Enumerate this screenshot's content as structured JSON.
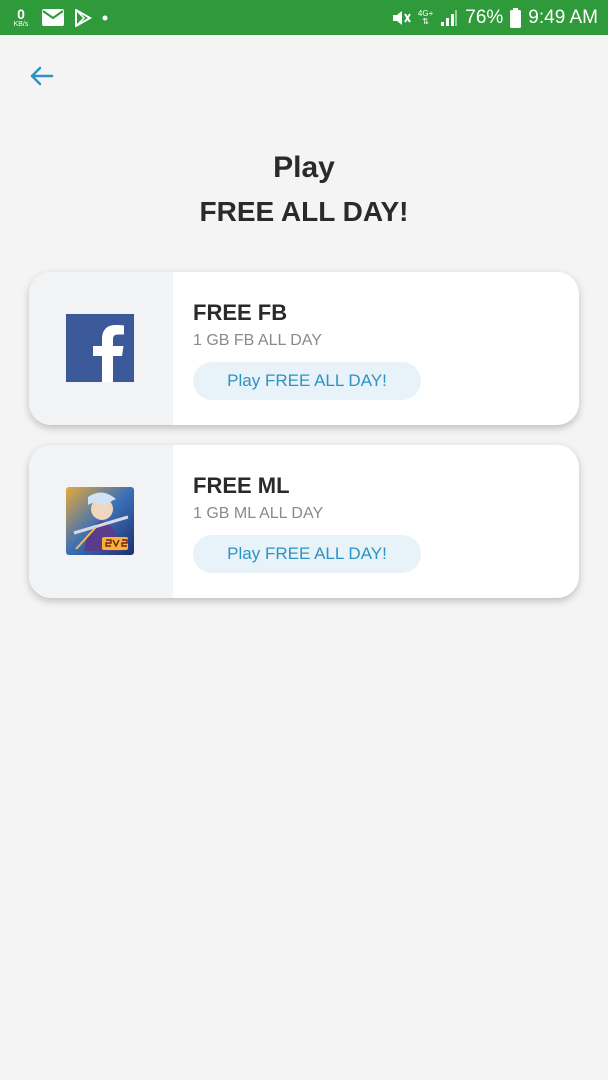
{
  "status_bar": {
    "net_speed_value": "0",
    "net_speed_unit": "KB/s",
    "network_type": "4G+",
    "battery": "76%",
    "time": "9:49 AM",
    "bg_color": "#2e9a3a"
  },
  "heading": {
    "line1": "Play",
    "line2": "FREE ALL DAY!"
  },
  "cards": [
    {
      "icon": "facebook-icon",
      "title": "FREE FB",
      "subtitle": "1 GB FB ALL DAY",
      "button": "Play FREE ALL DAY!"
    },
    {
      "icon": "mobile-legends-icon",
      "title": "FREE ML",
      "subtitle": "1 GB ML ALL DAY",
      "button": "Play FREE ALL DAY!"
    }
  ],
  "colors": {
    "accent": "#2d93c3",
    "pill_bg": "#e8f2f9",
    "facebook": "#3b5998"
  }
}
